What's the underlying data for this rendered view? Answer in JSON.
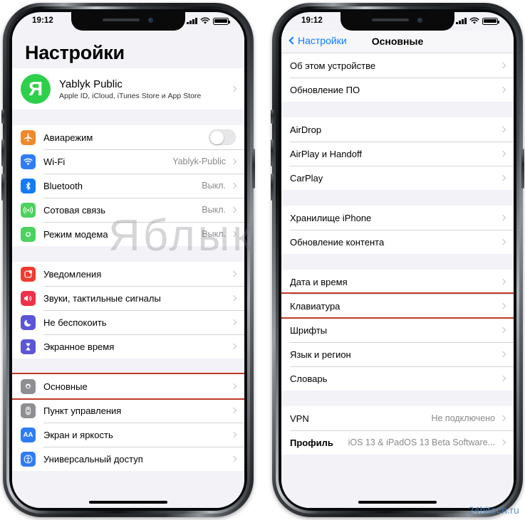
{
  "watermarks": {
    "brand": "Яблык",
    "site": "24hitech.ru"
  },
  "colors": {
    "highlight": "#c0392b",
    "accent_blue": "#0a7cff",
    "avatar_green": "#2ed04b",
    "screen_bg": "#f2f2f7"
  },
  "left_phone": {
    "status_bar": {
      "time": "19:12",
      "signal_icon": "cellular-bars-icon",
      "wifi_icon": "wifi-icon",
      "battery_icon": "battery-full-icon"
    },
    "title": "Настройки",
    "account": {
      "avatar_letter": "Я",
      "name": "Yablyk Public",
      "subtitle": "Apple ID, iCloud, iTunes Store и App Store"
    },
    "group_connectivity": [
      {
        "label": "Авиарежим",
        "icon": "airplane-icon",
        "icon_color": "#f0892a",
        "control": "toggle",
        "toggle_on": false
      },
      {
        "label": "Wi-Fi",
        "icon": "wifi-icon",
        "icon_color": "#2f7cf6",
        "value": "Yablyk-Public"
      },
      {
        "label": "Bluetooth",
        "icon": "bluetooth-icon",
        "icon_color": "#137bf8",
        "value": "Выкл."
      },
      {
        "label": "Сотовая связь",
        "icon": "cellular-icon",
        "icon_color": "#4cd25f",
        "value": "Выкл."
      },
      {
        "label": "Режим модема",
        "icon": "hotspot-icon",
        "icon_color": "#4cd25f",
        "value": "Выкл."
      }
    ],
    "group_alerts": [
      {
        "label": "Уведомления",
        "icon": "notifications-icon",
        "icon_color": "#f03b2f"
      },
      {
        "label": "Звуки, тактильные сигналы",
        "icon": "sounds-icon",
        "icon_color": "#f0314b"
      },
      {
        "label": "Не беспокоить",
        "icon": "moon-icon",
        "icon_color": "#5b56d6"
      },
      {
        "label": "Экранное время",
        "icon": "hourglass-icon",
        "icon_color": "#5b56d6"
      }
    ],
    "group_system": [
      {
        "label": "Основные",
        "icon": "gear-icon",
        "icon_color": "#8e8e93",
        "highlighted": true
      },
      {
        "label": "Пункт управления",
        "icon": "control-center-icon",
        "icon_color": "#8e8e93"
      },
      {
        "label": "Экран и яркость",
        "icon": "display-icon",
        "icon_color": "#2f7cf6",
        "icon_text": "AA"
      },
      {
        "label": "Универсальный доступ",
        "icon": "accessibility-icon",
        "icon_color": "#2f7cf6"
      }
    ]
  },
  "right_phone": {
    "status_bar": {
      "time": "19:12",
      "signal_icon": "cellular-bars-icon",
      "wifi_icon": "wifi-icon",
      "battery_icon": "battery-full-icon"
    },
    "nav": {
      "back_label": "Настройки",
      "back_icon": "chevron-left-icon",
      "title": "Основные"
    },
    "group_device": [
      {
        "label": "Об этом устройстве"
      },
      {
        "label": "Обновление ПО"
      }
    ],
    "group_sharing": [
      {
        "label": "AirDrop"
      },
      {
        "label": "AirPlay и Handoff"
      },
      {
        "label": "CarPlay"
      }
    ],
    "group_storage": [
      {
        "label": "Хранилище iPhone"
      },
      {
        "label": "Обновление контента"
      }
    ],
    "group_locale": [
      {
        "label": "Дата и время"
      },
      {
        "label": "Клавиатура",
        "highlighted": true
      },
      {
        "label": "Шрифты"
      },
      {
        "label": "Язык и регион"
      },
      {
        "label": "Словарь"
      }
    ],
    "group_network": [
      {
        "label": "VPN",
        "value": "Не подключено"
      },
      {
        "label": "Профиль",
        "value": "iOS 13 & iPadOS 13 Beta Software..."
      }
    ]
  }
}
